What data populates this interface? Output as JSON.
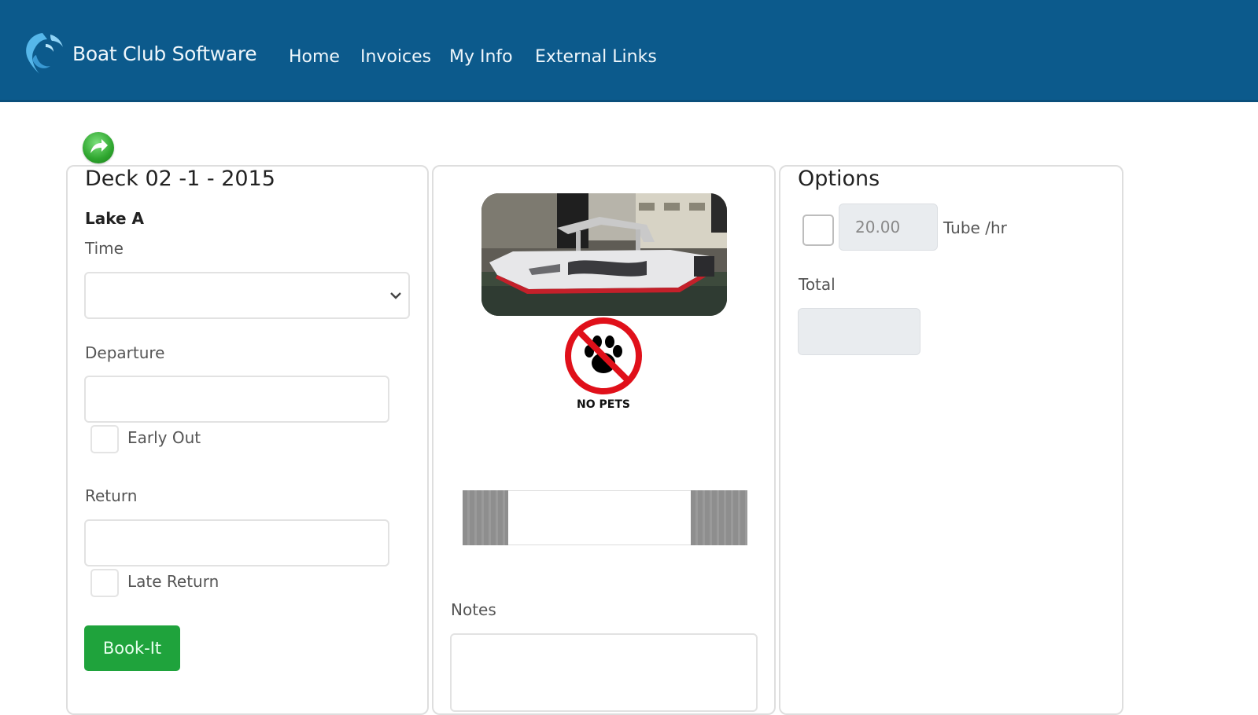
{
  "brand": {
    "name": "Boat Club Software",
    "icon": "swirl-logo-icon"
  },
  "nav": {
    "items": [
      {
        "label": "Home"
      },
      {
        "label": "Invoices"
      },
      {
        "label": "My Info"
      },
      {
        "label": "External Links"
      }
    ]
  },
  "back_button": {
    "icon": "green-arrow-icon"
  },
  "booking": {
    "title": "Deck 02 -1 - 2015",
    "location": "Lake A",
    "time_label": "Time",
    "time_value": "",
    "departure_label": "Departure",
    "departure_value": "",
    "early_out_label": "Early Out",
    "return_label": "Return",
    "return_value": "",
    "late_return_label": "Late Return",
    "book_button": "Book-It"
  },
  "boat": {
    "photo_icon": "boat-photo",
    "no_pets_icon": "no-pets-icon",
    "no_pets_text": "NO PETS",
    "notes_label": "Notes",
    "notes_value": ""
  },
  "options": {
    "title": "Options",
    "tube_price": "20.00",
    "tube_label": "Tube /hr",
    "total_label": "Total",
    "total_value": ""
  },
  "colors": {
    "navbar": "#0c5a8c",
    "book_button": "#1fa33c",
    "no_pets_red": "#e0101a"
  }
}
